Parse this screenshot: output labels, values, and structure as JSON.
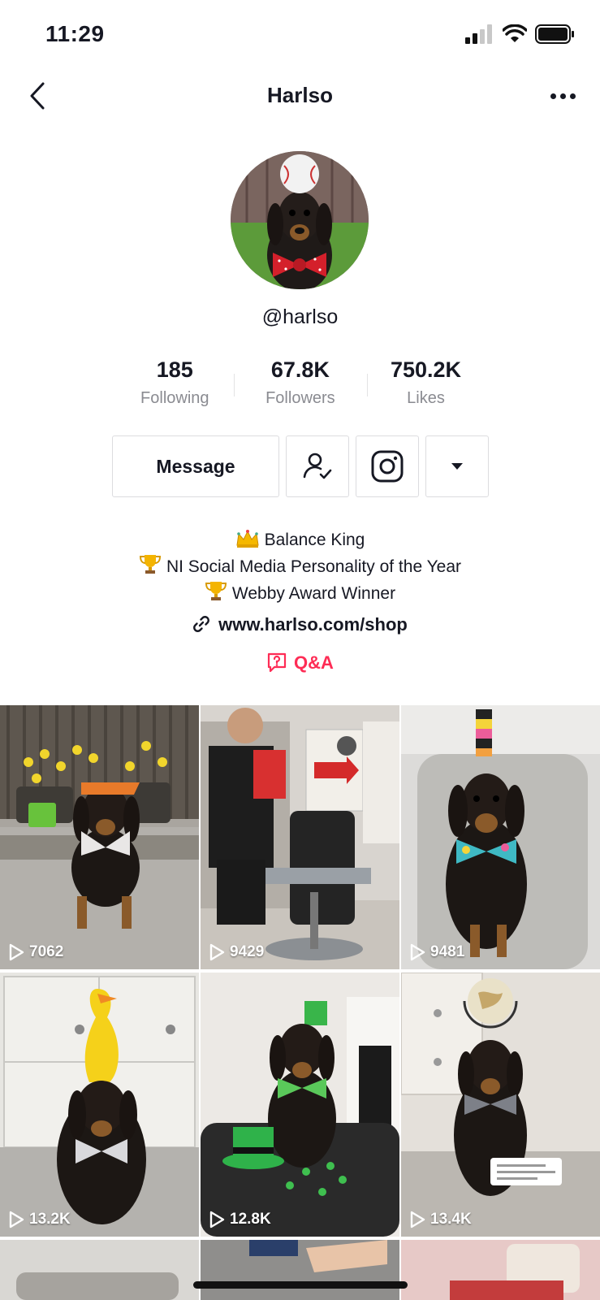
{
  "status_bar": {
    "time": "11:29"
  },
  "nav": {
    "title": "Harlso"
  },
  "profile": {
    "handle": "@harlso",
    "stats": [
      {
        "value": "185",
        "label": "Following"
      },
      {
        "value": "67.8K",
        "label": "Followers"
      },
      {
        "value": "750.2K",
        "label": "Likes"
      }
    ],
    "message_label": "Message",
    "bio": [
      {
        "emoji": "crown",
        "text": "Balance King"
      },
      {
        "emoji": "trophy",
        "text": "NI Social Media Personality of the Year"
      },
      {
        "emoji": "trophy",
        "text": "Webby Award Winner"
      }
    ],
    "link": "www.harlso.com/shop",
    "qa_label": "Q&A"
  },
  "videos": [
    {
      "views": "7062"
    },
    {
      "views": "9429"
    },
    {
      "views": "9481"
    },
    {
      "views": "13.2K"
    },
    {
      "views": "12.8K"
    },
    {
      "views": "13.4K"
    }
  ],
  "colors": {
    "accent": "#fe2c55",
    "text": "#161823",
    "muted": "#8a8b91"
  }
}
